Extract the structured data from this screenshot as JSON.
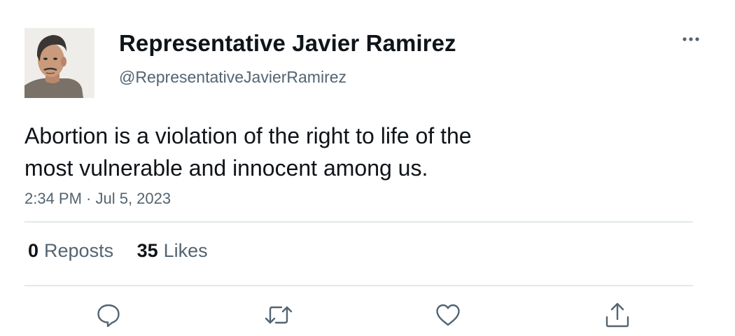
{
  "author": {
    "display_name": "Representative Javier Ramirez",
    "handle": "@RepresentativeJavierRamirez",
    "avatar_icon": "person-portrait"
  },
  "tweet": {
    "text_line_1": "Abortion is a violation of the right to life of the",
    "text_line_2": "most vulnerable and innocent among us.",
    "timestamp": "2:34 PM · Jul 5, 2023"
  },
  "stats": {
    "reposts_count": "0",
    "reposts_label": "Reposts",
    "likes_count": "35",
    "likes_label": "Likes"
  },
  "actions": {
    "reply_icon": "comment-icon",
    "repost_icon": "repost-icon",
    "like_icon": "heart-icon",
    "share_icon": "share-icon",
    "more_icon": "more-dots-icon"
  },
  "colors": {
    "text_primary": "#0f1419",
    "text_secondary": "#536471",
    "divider": "#e1e8ed",
    "icon": "#536471"
  }
}
